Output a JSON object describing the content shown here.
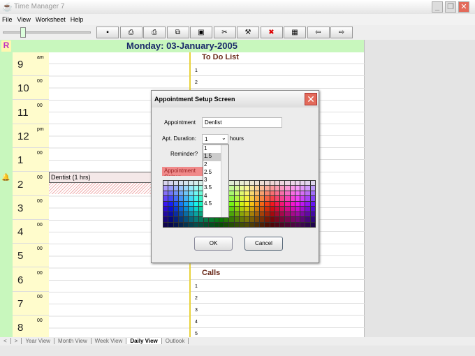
{
  "window": {
    "title": "Time Manager 7"
  },
  "menu": [
    "File",
    "View",
    "Worksheet",
    "Help"
  ],
  "toolbar": [
    {
      "icon": "save-icon",
      "glyph": "▪"
    },
    {
      "icon": "print-icon",
      "glyph": "⎙"
    },
    {
      "icon": "print-preview-icon",
      "glyph": "⎙"
    },
    {
      "icon": "copy-icon",
      "glyph": "⧉"
    },
    {
      "icon": "paste-icon",
      "glyph": "▣"
    },
    {
      "icon": "cut-icon",
      "glyph": "✂"
    },
    {
      "icon": "tool-icon",
      "glyph": "⚒"
    },
    {
      "icon": "delete-icon",
      "glyph": "✖"
    },
    {
      "icon": "calendar-icon",
      "glyph": "▦"
    },
    {
      "icon": "back-arrow-icon",
      "glyph": "⇦"
    },
    {
      "icon": "forward-arrow-icon",
      "glyph": "⇨"
    }
  ],
  "header": {
    "r": "R",
    "date": "Monday: 03-January-2005"
  },
  "hours": [
    {
      "h": "9",
      "m": "am"
    },
    {
      "h": "10",
      "m": "00"
    },
    {
      "h": "11",
      "m": "00"
    },
    {
      "h": "12",
      "m": "pm"
    },
    {
      "h": "1",
      "m": "00"
    },
    {
      "h": "2",
      "m": "00"
    },
    {
      "h": "3",
      "m": "00"
    },
    {
      "h": "4",
      "m": "00"
    },
    {
      "h": "5",
      "m": "00"
    },
    {
      "h": "6",
      "m": "00"
    },
    {
      "h": "7",
      "m": "00"
    },
    {
      "h": "8",
      "m": "00"
    }
  ],
  "appointment": "Dentist  (1 hrs)",
  "todo": {
    "title": "To Do List",
    "items": [
      "1",
      "2"
    ]
  },
  "calls": {
    "title": "Calls",
    "items": [
      "1",
      "2",
      "3",
      "4",
      "5"
    ]
  },
  "tabs": [
    "<",
    ">",
    "Year View",
    "Month View",
    "Week View",
    "Daily View",
    "Outlook"
  ],
  "dialog": {
    "title": "Appointment Setup Screen",
    "appointment_label": "Appointment",
    "appointment_value": "Denlist",
    "duration_label": "Apt. Duration:",
    "duration_value": "1",
    "hours_label": "hours",
    "reminder_label": "Reminder?",
    "color_label": "Appointment Colour",
    "options": [
      "1",
      "1.5",
      "2",
      "2.5",
      "3",
      "3.5",
      "4",
      "4.5"
    ],
    "ok": "OK",
    "cancel": "Cancel"
  },
  "colors": {
    "header": "#c8f7bd",
    "timecol": "#fffccc",
    "accent": "#1a2a6a"
  }
}
